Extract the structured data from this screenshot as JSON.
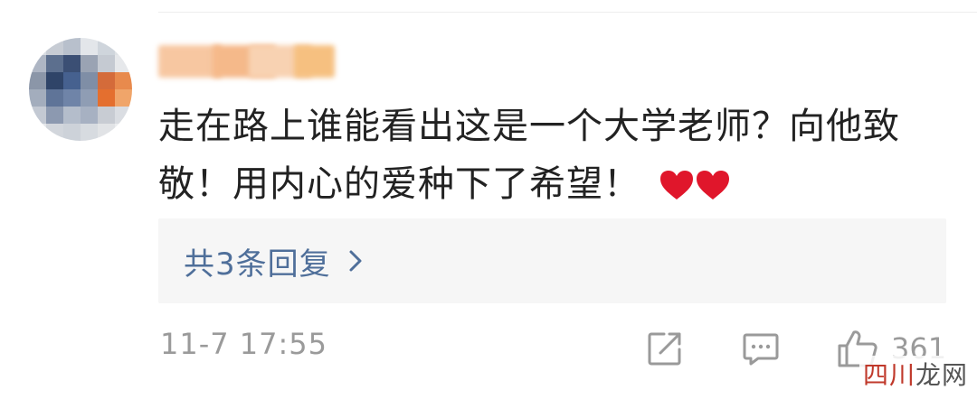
{
  "comment": {
    "text": "走在路上谁能看出这是一个大学老师？向他致敬！用内心的爱种下了希望！",
    "emoji": "heart-icon-x2"
  },
  "replies": {
    "label": "共3条回复"
  },
  "meta": {
    "timestamp": "11-7 17:55",
    "like_count": "361"
  },
  "watermark": {
    "part1": "四川",
    "part2": "龙网"
  },
  "colors": {
    "reply_link": "#4f6f9a",
    "meta_gray": "#9a9a9a",
    "heart": "#e0162b",
    "reply_bg": "#f6f6f6"
  }
}
